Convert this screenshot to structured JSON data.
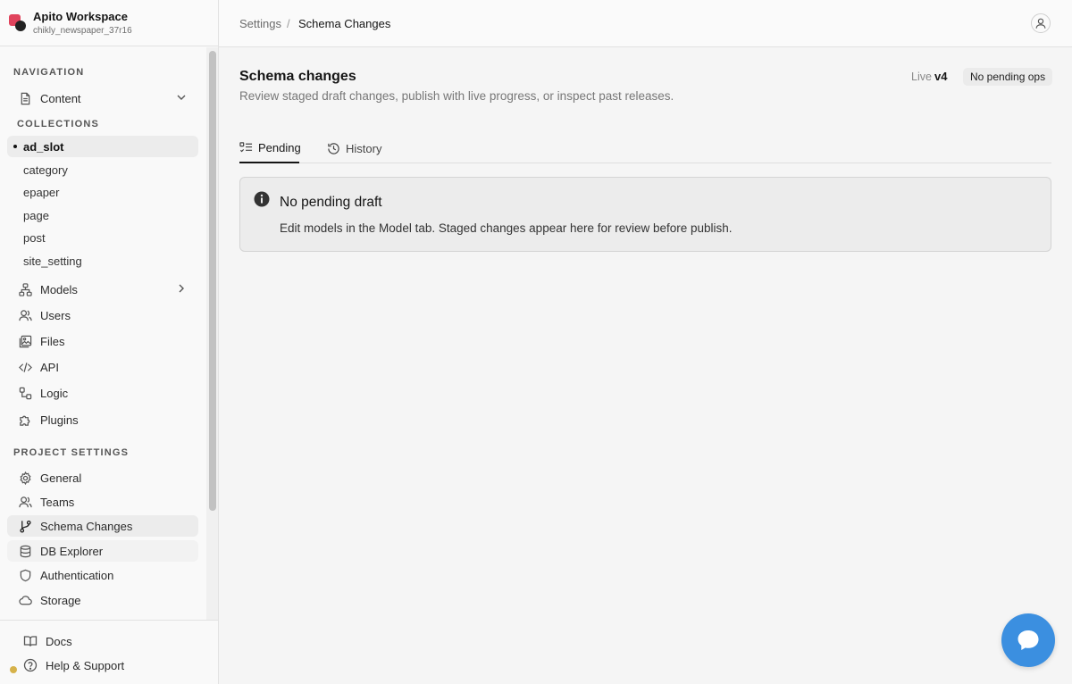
{
  "workspace": {
    "name": "Apito Workspace",
    "project": "chikly_newspaper_37r16"
  },
  "sidebar": {
    "navigation_label": "NAVIGATION",
    "content_label": "Content",
    "collections_label": "COLLECTIONS",
    "collections": [
      "ad_slot",
      "category",
      "epaper",
      "page",
      "post",
      "site_setting"
    ],
    "models_label": "Models",
    "users_label": "Users",
    "files_label": "Files",
    "api_label": "API",
    "logic_label": "Logic",
    "plugins_label": "Plugins",
    "project_settings_label": "PROJECT SETTINGS",
    "general_label": "General",
    "teams_label": "Teams",
    "schema_changes_label": "Schema Changes",
    "db_explorer_label": "DB Explorer",
    "authentication_label": "Authentication",
    "storage_label": "Storage",
    "docs_label": "Docs",
    "help_label": "Help & Support"
  },
  "breadcrumb": {
    "parent": "Settings",
    "separator": "/",
    "current": "Schema Changes"
  },
  "page": {
    "title": "Schema changes",
    "subtitle": "Review staged draft changes, publish with live progress, or inspect past releases.",
    "live_label": "Live",
    "live_version": "v4",
    "pending_badge": "No pending ops"
  },
  "tabs": {
    "pending": "Pending",
    "history": "History"
  },
  "alert": {
    "title": "No pending draft",
    "body": "Edit models in the Model tab. Staged changes appear here for review before publish."
  },
  "colors": {
    "accent": "#3b8fe0",
    "status_dot": "#d6b24a"
  }
}
